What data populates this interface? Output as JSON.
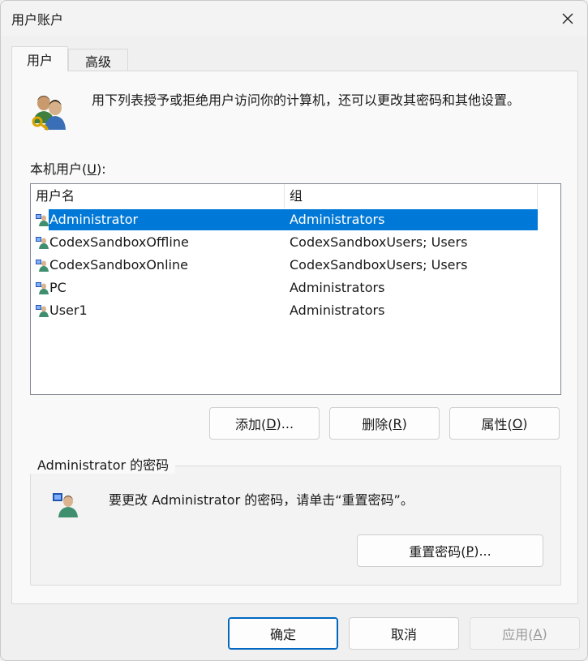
{
  "window": {
    "title": "用户账户",
    "close_icon": "close-icon"
  },
  "tabs": [
    {
      "label": "用户",
      "active": true
    },
    {
      "label": "高级",
      "active": false
    }
  ],
  "intro": {
    "icon": "users-keys-icon",
    "text": "用下列表授予或拒绝用户访问你的计算机，还可以更改其密码和其他设置。"
  },
  "local_users": {
    "label_prefix": "本机用户(",
    "label_hotkey": "U",
    "label_suffix": "):",
    "columns": [
      "用户名",
      "组"
    ],
    "rows": [
      {
        "name": "Administrator",
        "group": "Administrators",
        "selected": true
      },
      {
        "name": "CodexSandboxOffline",
        "group": "CodexSandboxUsers; Users",
        "selected": false
      },
      {
        "name": "CodexSandboxOnline",
        "group": "CodexSandboxUsers; Users",
        "selected": false
      },
      {
        "name": "PC",
        "group": "Administrators",
        "selected": false
      },
      {
        "name": "User1",
        "group": "Administrators",
        "selected": false
      }
    ]
  },
  "actions": {
    "add": {
      "prefix": "添加(",
      "hotkey": "D",
      "suffix": ")..."
    },
    "delete": {
      "prefix": "删除(",
      "hotkey": "R",
      "suffix": ")"
    },
    "properties": {
      "prefix": "属性(",
      "hotkey": "O",
      "suffix": ")"
    }
  },
  "password_group": {
    "title": "Administrator 的密码",
    "icon": "user-icon",
    "text": "要更改 Administrator 的密码，请单击“重置密码”。",
    "reset": {
      "prefix": "重置密码(",
      "hotkey": "P",
      "suffix": ")..."
    }
  },
  "footer": {
    "ok": "确定",
    "cancel": "取消",
    "apply": {
      "prefix": "应用(",
      "hotkey": "A",
      "suffix": ")",
      "disabled": true
    }
  },
  "colors": {
    "selection": "#0078d7",
    "ok_border": "#0067c0"
  }
}
